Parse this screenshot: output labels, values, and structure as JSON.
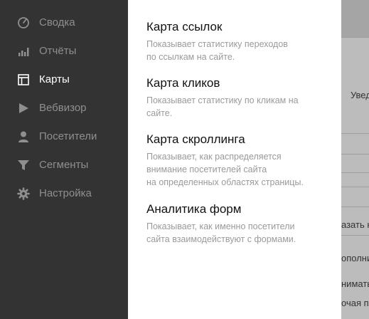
{
  "sidebar": {
    "items": [
      {
        "label": "Сводка",
        "icon": "gauge-icon",
        "active": false
      },
      {
        "label": "Отчёты",
        "icon": "bar-chart-icon",
        "active": false
      },
      {
        "label": "Карты",
        "icon": "map-layout-icon",
        "active": true
      },
      {
        "label": "Вебвизор",
        "icon": "play-icon",
        "active": false
      },
      {
        "label": "Посетители",
        "icon": "user-icon",
        "active": false
      },
      {
        "label": "Сегменты",
        "icon": "filter-icon",
        "active": false
      },
      {
        "label": "Настройка",
        "icon": "gear-icon",
        "active": false
      }
    ]
  },
  "maps_menu": {
    "items": [
      {
        "title": "Карта ссылок",
        "description": "Показывает статистику переходов\nпо ссылкам на сайте."
      },
      {
        "title": "Карта кликов",
        "description": "Показывает статистику по кликам на\nсайте."
      },
      {
        "title": "Карта скроллинга",
        "description": "Показывает, как распределяется\nвнимание посетителей сайта\nна определенных областях страницы."
      },
      {
        "title": "Аналитика форм",
        "description": "Показывает, как именно посетители\nсайта взаимодействуют с формами."
      }
    ]
  },
  "background_page": {
    "fragments": [
      "Увед",
      "азать к",
      "ополни",
      "нимать",
      "очая по"
    ]
  },
  "colors": {
    "sidebar_bg": "#333333",
    "sidebar_text": "#8f8f8f",
    "sidebar_active_text": "#ffffff",
    "panel_bg": "#ffffff",
    "overlay_bg": "#bcbcbc"
  }
}
